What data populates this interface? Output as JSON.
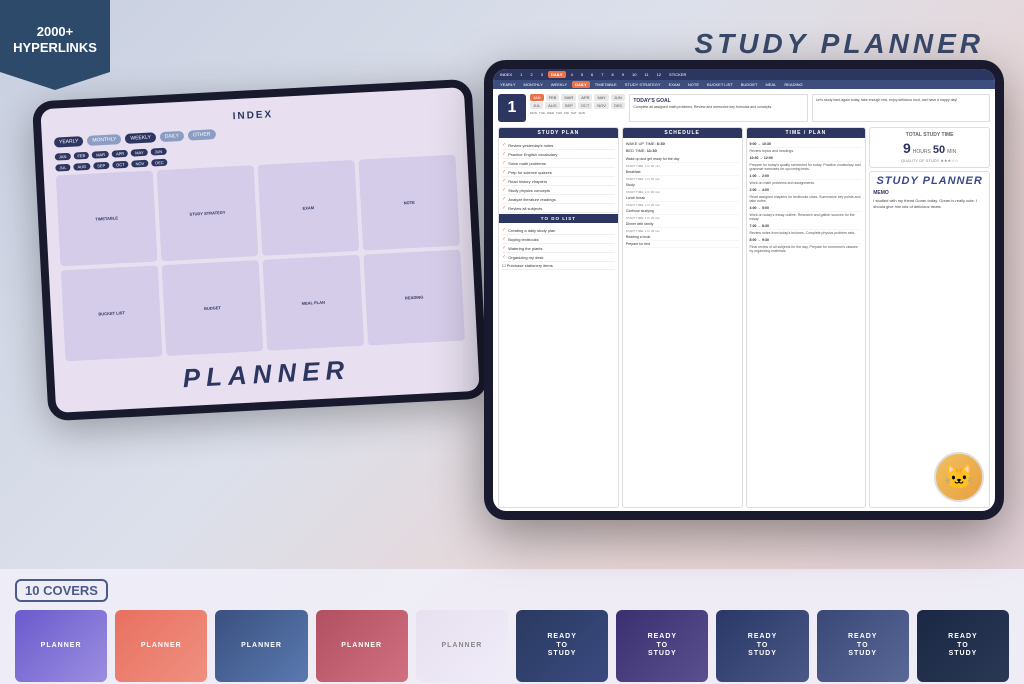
{
  "banner": {
    "line1": "2000+",
    "line2": "HYPERLINKS"
  },
  "title": "STUDY PLANNER",
  "back_tablet": {
    "index_title": "INDEX",
    "nav_items": [
      "YEARLY",
      "MONTHLY",
      "WEEKLY",
      "DAILY",
      "OTHER"
    ],
    "months": [
      "JAN",
      "FEB",
      "MAR",
      "APR",
      "MAY",
      "JUN",
      "JUL",
      "AUG",
      "SEP",
      "OCT",
      "NOV",
      "DEC"
    ],
    "grid_items": [
      "TIMETABLE",
      "STUDY STRATEGY",
      "EXAM",
      "NOTE",
      "BUCKET LIST",
      "BUDGET",
      "MEAL PLAN",
      "READING"
    ],
    "planner_label": "PLANNER"
  },
  "front_tablet": {
    "nav_items": [
      "INDEX",
      "1",
      "2",
      "3",
      "DAILY",
      "4",
      "5",
      "6",
      "7",
      "8",
      "9",
      "10",
      "11",
      "12",
      "STICKER"
    ],
    "nav2_items": [
      "YEARLY",
      "MONTHLY",
      "WEEKLY",
      "DAILY",
      "TIMETABLE",
      "STUDY STRATEGY",
      "EXAM",
      "NOTE",
      "BUCKET LIST",
      "BUDGET",
      "MEAL",
      "READING"
    ],
    "date": "1",
    "months": [
      "JAN",
      "FEB",
      "MAR",
      "APR",
      "MAY",
      "JUN",
      "JUL",
      "AUG",
      "SEP",
      "OCT",
      "NOV",
      "DEC"
    ],
    "goal_title": "TODAY'S GOAL",
    "goal_text": "Complete all assigned math problems. Review and memorize key formulas and concepts.",
    "happy_text": "Let's study hard again today, take enough rest, enjoy delicious food, and have a happy day!",
    "study_plan": {
      "title": "STUDY PLAN",
      "items": [
        "Review yesterday's notes",
        "Practice English vocabulary",
        "Solve math problems",
        "Prep for science quizzes",
        "Read history chapters",
        "Study physics concepts",
        "Analyze literature readings",
        "Review all subjects"
      ]
    },
    "schedule": {
      "title": "SCHEDULE",
      "wake_time": "6:30",
      "bed_time": "11:30",
      "items": [
        "Wake up and get ready for the day",
        "Breakfast",
        "Study",
        "Lunch break",
        "Continue studying",
        "Dinner with family",
        "Reading a book",
        "Prepare for bed"
      ]
    },
    "time_plan": {
      "title": "TIME / PLAN",
      "items": [
        "9:00 → 10:30",
        "10:30 → 12:00",
        "1:00 → 2:00",
        "2:00 → 4:00",
        "4:00 → 5:00",
        "7:00 → 8:30",
        "8:00 → 9:30"
      ]
    },
    "total_study": {
      "title": "TOTAL STUDY TIME",
      "hours": "9",
      "minutes": "50",
      "unit_h": "HOURS",
      "unit_m": "MIN"
    },
    "memo": {
      "title": "MEMO",
      "text": "I studied with my friend Goran today. Goran is really cute. I should give him lots of delicious treats."
    },
    "todo": {
      "title": "TO DO LIST",
      "items": [
        "Creating a daily study plan",
        "Buying textbooks",
        "Watering the plants",
        "Organizing my desk",
        "Purchase stationery items"
      ]
    }
  },
  "covers": {
    "label": "10 COVERS",
    "items": [
      {
        "text": "PLANNER",
        "style": "cover-1"
      },
      {
        "text": "PLANNER",
        "style": "cover-2"
      },
      {
        "text": "PLANNER",
        "style": "cover-3"
      },
      {
        "text": "PLANNER",
        "style": "cover-4"
      },
      {
        "text": "PLANNER",
        "style": "cover-5"
      },
      {
        "text": "READY TO STUDY",
        "style": "cover-6"
      },
      {
        "text": "READY TO STUDY",
        "style": "cover-7"
      },
      {
        "text": "READY TO STUDY",
        "style": "cover-8"
      },
      {
        "text": "READY TO STUDY",
        "style": "cover-9"
      },
      {
        "text": "READY TO STUDY",
        "style": "cover-10"
      }
    ]
  }
}
